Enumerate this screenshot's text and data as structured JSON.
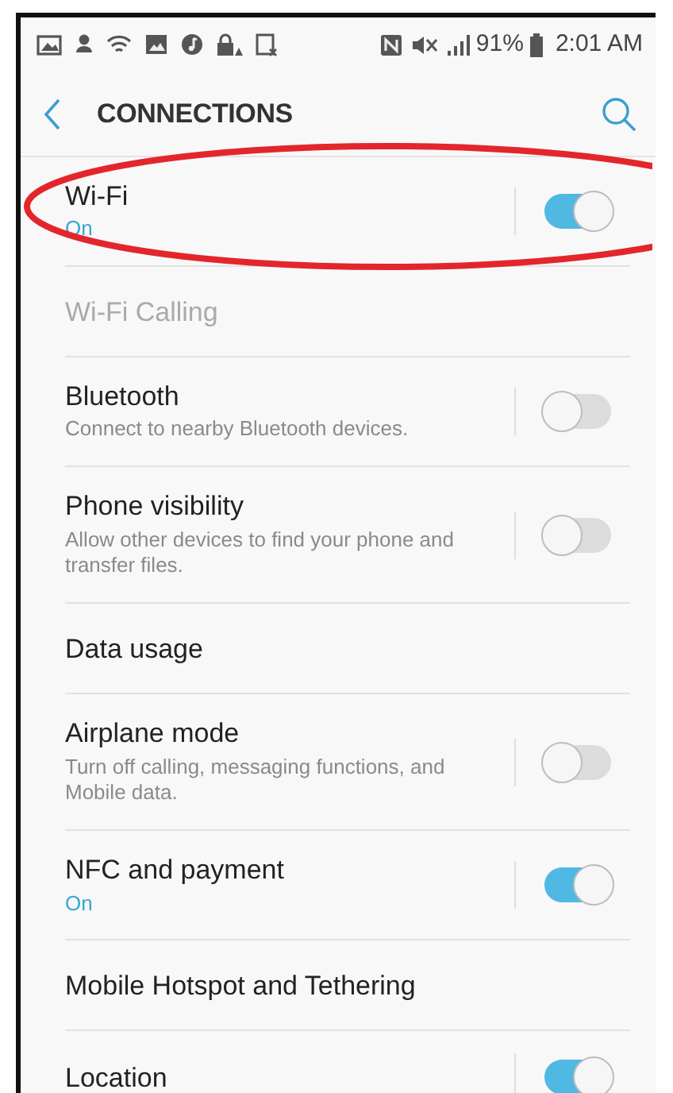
{
  "status_bar": {
    "battery": "91%",
    "time": "2:01 AM"
  },
  "header": {
    "title": "CONNECTIONS"
  },
  "settings": [
    {
      "kind": "switch",
      "title": "Wi-Fi",
      "subtitle": "On",
      "on": true,
      "disabled": false,
      "highlighted": true
    },
    {
      "kind": "link",
      "title": "Wi-Fi Calling",
      "disabled": true,
      "highlighted": false
    },
    {
      "kind": "switch",
      "title": "Bluetooth",
      "subtitle": "Connect to nearby Bluetooth devices.",
      "on": false,
      "disabled": false,
      "highlighted": false
    },
    {
      "kind": "switch",
      "title": "Phone visibility",
      "subtitle": "Allow other devices to find your phone and transfer files.",
      "on": false,
      "disabled": false,
      "highlighted": false
    },
    {
      "kind": "link",
      "title": "Data usage",
      "disabled": false,
      "highlighted": false
    },
    {
      "kind": "switch",
      "title": "Airplane mode",
      "subtitle": "Turn off calling, messaging functions, and Mobile data.",
      "on": false,
      "disabled": false,
      "highlighted": false
    },
    {
      "kind": "switch",
      "title": "NFC and payment",
      "subtitle": "On",
      "on": true,
      "disabled": false,
      "highlighted": false
    },
    {
      "kind": "link",
      "title": "Mobile Hotspot and Tethering",
      "disabled": false,
      "highlighted": false
    },
    {
      "kind": "switch",
      "title": "Location",
      "on": true,
      "disabled": false,
      "highlighted": false
    }
  ]
}
